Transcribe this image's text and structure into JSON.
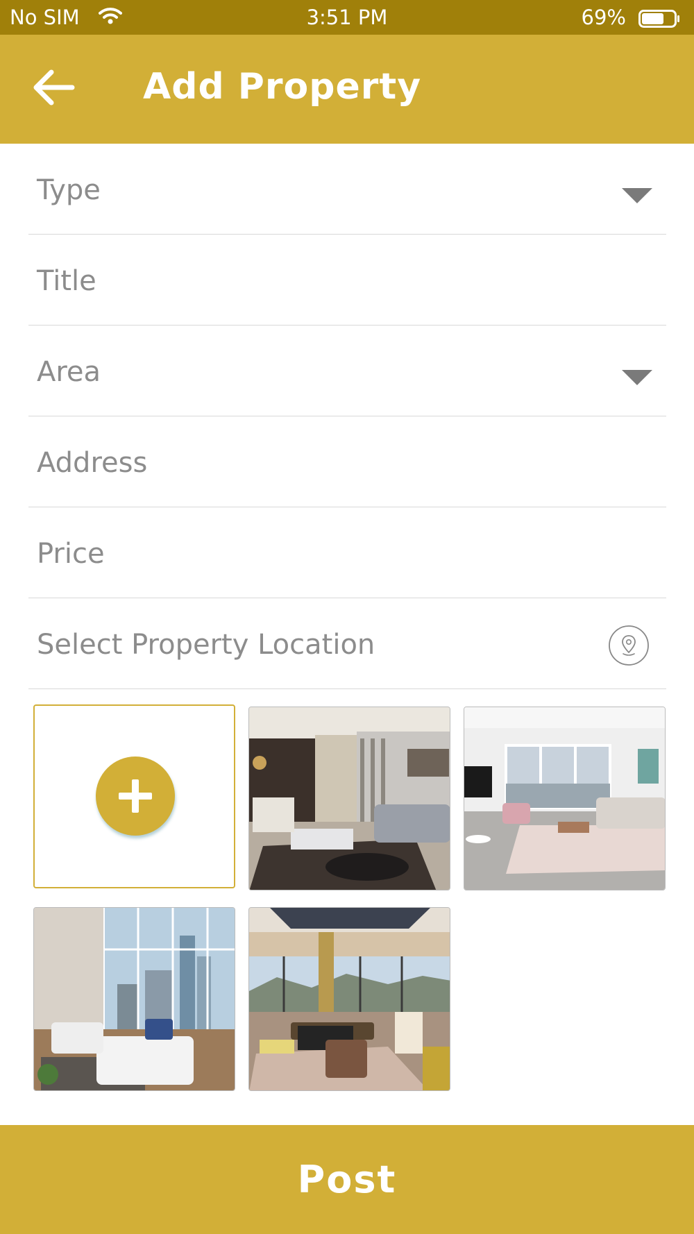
{
  "status_bar": {
    "carrier": "No SIM",
    "time": "3:51 PM",
    "battery": "69%",
    "battery_level": 0.69
  },
  "header": {
    "title": "Add Property",
    "back_icon": "arrow-left-icon"
  },
  "form": {
    "fields": [
      {
        "label": "Type",
        "control": "dropdown"
      },
      {
        "label": "Title",
        "control": "text"
      },
      {
        "label": "Area",
        "control": "dropdown"
      },
      {
        "label": "Address",
        "control": "text"
      },
      {
        "label": "Price",
        "control": "text"
      },
      {
        "label": "Select Property Location",
        "control": "location-picker"
      }
    ]
  },
  "photos": {
    "add_icon": "plus-icon",
    "items": [
      {
        "name": "photo-living-room-dark"
      },
      {
        "name": "photo-living-room-white"
      },
      {
        "name": "photo-living-room-city-view"
      },
      {
        "name": "photo-living-room-mountain-view"
      }
    ]
  },
  "actions": {
    "post_label": "Post"
  },
  "colors": {
    "accent": "#d2af37",
    "status_bar": "#a0800a",
    "divider": "#d8d8d8",
    "label_text": "#8c8c8c"
  }
}
